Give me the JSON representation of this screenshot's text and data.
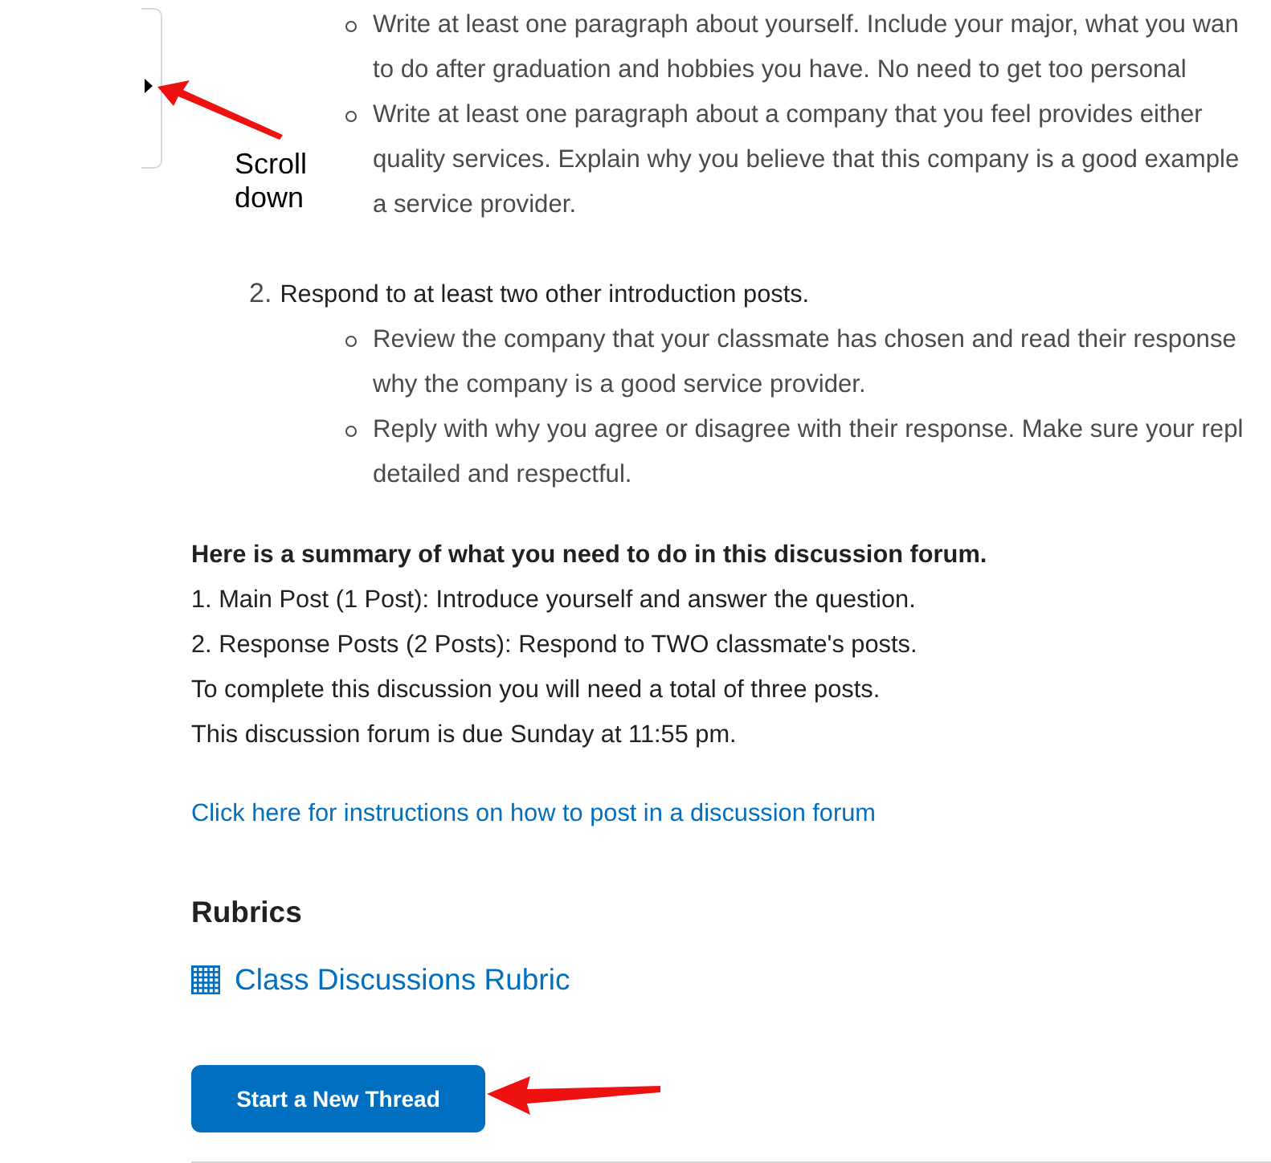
{
  "side_tab": {
    "annotation": "Scroll\ndown"
  },
  "top_bullets": [
    "Write at least one paragraph about yourself. Include your major, what you wan\nto do after graduation and hobbies you have. No need to get too personal",
    "Write at least one paragraph about a company that you feel provides either\nquality services. Explain why you believe that this company is a good example\na service provider."
  ],
  "step": {
    "number": "2.",
    "text": "Respond to at least two other introduction posts.",
    "bullets": [
      "Review the company that your classmate has chosen and read their response\nwhy the company is a good service provider.",
      "Reply with why you agree or disagree with their response. Make sure your repl\ndetailed and respectful."
    ]
  },
  "summary": {
    "heading": "Here is a summary of what you need to do in this discussion forum.",
    "lines": [
      "1. Main Post (1 Post): Introduce yourself and answer the question.",
      "2. Response Posts (2 Posts): Respond to TWO classmate's posts.",
      "To complete this discussion you will need a total of three posts.",
      "This discussion forum is due Sunday at 11:55 pm."
    ]
  },
  "help_link": "Click here for instructions on how to post in a discussion forum",
  "rubrics": {
    "heading": "Rubrics",
    "link": "Class Discussions Rubric"
  },
  "button": "Start a New Thread"
}
